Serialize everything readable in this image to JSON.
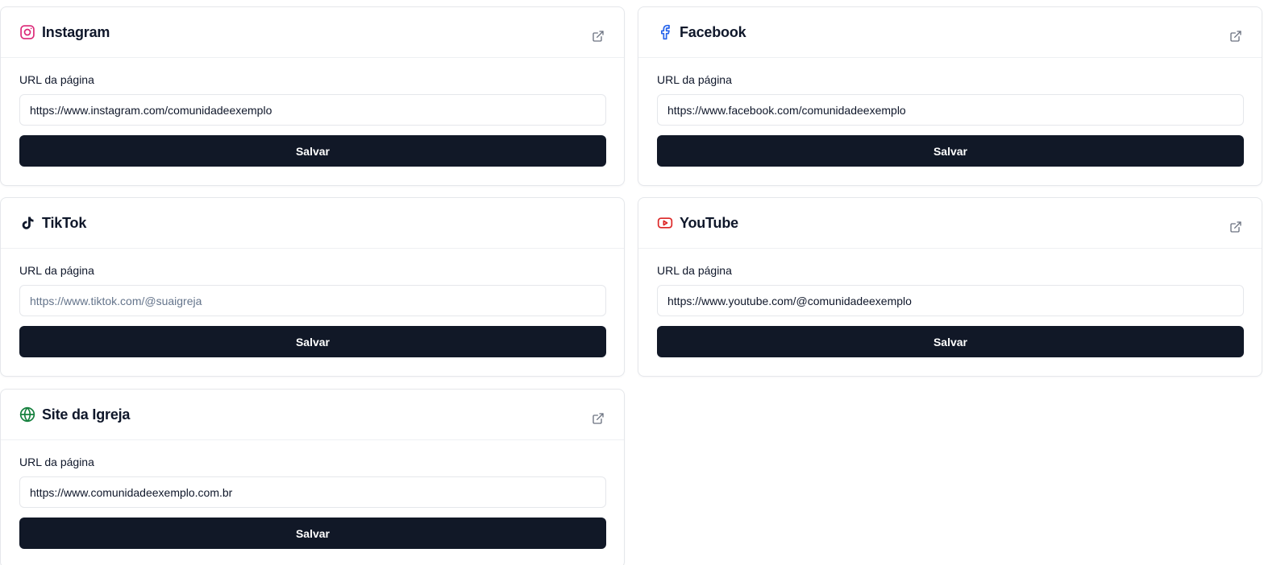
{
  "cards": [
    {
      "id": "instagram",
      "title": "Instagram",
      "label": "URL da página",
      "value": "https://www.instagram.com/comunidadeexemplo",
      "placeholder": "https://www.instagram.com/suaigreja",
      "button": "Salvar",
      "icon": "instagram-icon",
      "icon_color": "#db2777",
      "has_external_link": true
    },
    {
      "id": "facebook",
      "title": "Facebook",
      "label": "URL da página",
      "value": "https://www.facebook.com/comunidadeexemplo",
      "placeholder": "https://www.facebook.com/suaigreja",
      "button": "Salvar",
      "icon": "facebook-icon",
      "icon_color": "#2563eb",
      "has_external_link": true
    },
    {
      "id": "tiktok",
      "title": "TikTok",
      "label": "URL da página",
      "value": "",
      "placeholder": "https://www.tiktok.com/@suaigreja",
      "button": "Salvar",
      "icon": "tiktok-icon",
      "icon_color": "#0f172a",
      "has_external_link": false
    },
    {
      "id": "youtube",
      "title": "YouTube",
      "label": "URL da página",
      "value": "https://www.youtube.com/@comunidadeexemplo",
      "placeholder": "https://www.youtube.com/@suaigreja",
      "button": "Salvar",
      "icon": "youtube-icon",
      "icon_color": "#dc2626",
      "has_external_link": true
    },
    {
      "id": "site",
      "title": "Site da Igreja",
      "label": "URL da página",
      "value": "https://www.comunidadeexemplo.com.br",
      "placeholder": "https://www.suaigreja.com.br",
      "button": "Salvar",
      "icon": "globe-icon",
      "icon_color": "#15803d",
      "has_external_link": true
    }
  ],
  "colors": {
    "button_bg": "#111827",
    "border": "#e5e7eb",
    "external_link_icon": "#6b7280"
  }
}
